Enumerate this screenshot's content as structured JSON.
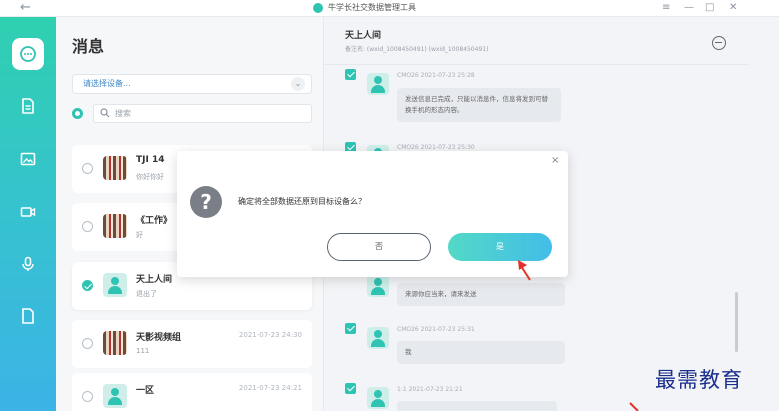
{
  "titlebar": {
    "back_icon": "arrow-left-icon",
    "app_title": "牛学长社交数据管理工具",
    "buttons": [
      "menu",
      "minimize",
      "maximize",
      "close"
    ],
    "button_glyphs": [
      "≡",
      "—",
      "□",
      "✕"
    ]
  },
  "nav": {
    "items": [
      {
        "icon": "chat-icon",
        "active": true
      },
      {
        "icon": "file-icon",
        "active": false
      },
      {
        "icon": "image-icon",
        "active": false
      },
      {
        "icon": "video-icon",
        "active": false
      },
      {
        "icon": "microphone-icon",
        "active": false
      },
      {
        "icon": "document-icon",
        "active": false
      }
    ]
  },
  "sidebar": {
    "heading": "消息",
    "device_select_value": "请选择设备...",
    "search_placeholder": "搜索",
    "conversations": [
      {
        "name": "TJI 14",
        "sub": "你好你好",
        "time": "",
        "checked": false,
        "avatar": "grid"
      },
      {
        "name": "《工作》",
        "sub": "好",
        "time": "",
        "checked": false,
        "avatar": "grid"
      },
      {
        "name": "天上人间",
        "sub": "退出了",
        "time": "",
        "checked": true,
        "avatar": "person"
      },
      {
        "name": "天影视频组",
        "sub": "111",
        "time": "2021-07-23 24:30",
        "checked": false,
        "avatar": "grid"
      },
      {
        "name": "一区",
        "sub": "",
        "time": "2021-07-23 24:21",
        "checked": false,
        "avatar": "person"
      }
    ]
  },
  "chat": {
    "title": "天上人间",
    "subtitle": "备注名: (wxid_1008450491) (wxid_1008450491)",
    "more_icon": "minus-circle-icon",
    "messages": [
      {
        "meta": "CMO26 2021-07-23 25:28",
        "text": "发送信息已完成，只能以消息件，信息将发到可替换手机的形态内容。"
      },
      {
        "meta": "CMO26 2021-07-23 25:30",
        "text": ""
      },
      {
        "meta": "",
        "text": "来源你应当来，请来发送"
      },
      {
        "meta": "CMO26 2021-07-23 25:31",
        "text": "我"
      },
      {
        "meta": "1:1 2021-07-23 21:21",
        "text": ""
      }
    ]
  },
  "dialog": {
    "close_glyph": "×",
    "icon": "question-icon",
    "icon_glyph": "?",
    "message": "确定将全部数据还原到目标设备么？",
    "no_label": "否",
    "yes_label": "是"
  },
  "watermark": "最需教育",
  "colors": {
    "accent": "#2fc3b4",
    "nav_gradient_top": "#2fd0b0",
    "nav_gradient_bottom": "#3bb3e6",
    "yes_button_start": "#52d9c6",
    "yes_button_end": "#42bde8",
    "annotation_arrow": "#e0312a",
    "watermark": "#1c2f8c"
  }
}
